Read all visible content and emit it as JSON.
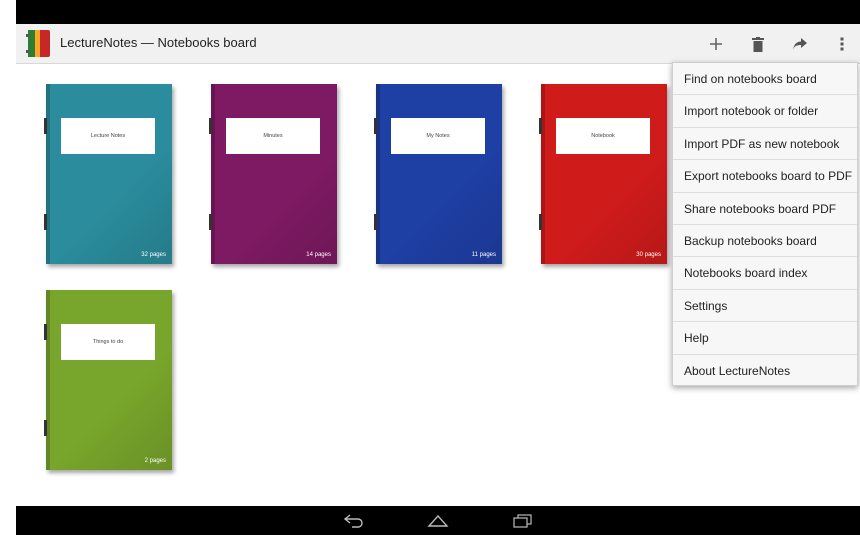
{
  "app": {
    "title": "LectureNotes — Notebooks board"
  },
  "actions": {
    "add_icon": "plus-icon",
    "delete_icon": "trash-icon",
    "share_icon": "share-icon",
    "overflow_icon": "overflow-menu-icon"
  },
  "notebooks": [
    {
      "title": "Lecture Notes",
      "pages": "32 pages",
      "color": "#2a8c9c"
    },
    {
      "title": "Minutes",
      "pages": "14 pages",
      "color": "#7e1a63"
    },
    {
      "title": "My Notes",
      "pages": "11 pages",
      "color": "#1e3fa4"
    },
    {
      "title": "Notebook",
      "pages": "30 pages",
      "color": "#d01b1b"
    },
    {
      "title": "Things to do",
      "pages": "2 pages",
      "color": "#78a52b"
    }
  ],
  "menu": {
    "items": [
      "Find on notebooks board",
      "Import notebook or folder",
      "Import PDF as new notebook",
      "Export notebooks board to PDF",
      "Share notebooks board PDF",
      "Backup notebooks board",
      "Notebooks board index",
      "Settings",
      "Help",
      "About LectureNotes"
    ]
  },
  "nav": {
    "back_icon": "back-icon",
    "home_icon": "home-icon",
    "recents_icon": "recents-icon"
  }
}
